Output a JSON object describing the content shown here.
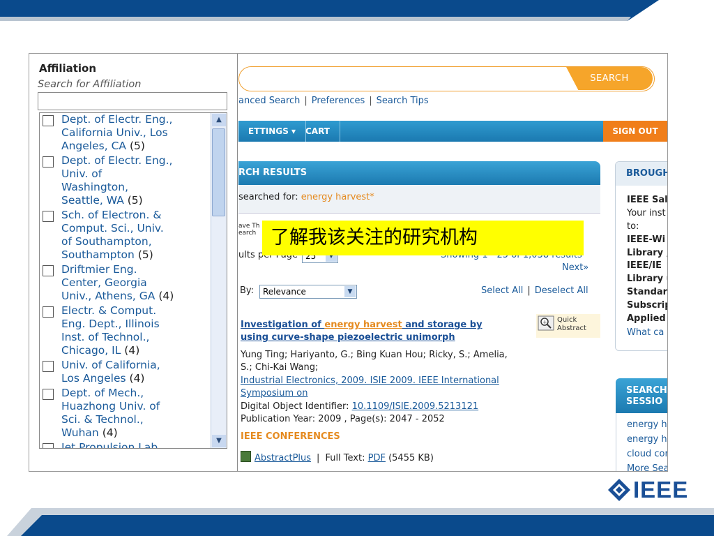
{
  "slide": {
    "callout": "了解我该关注的研究机构",
    "logo_text": "IEEE"
  },
  "header": {
    "search_button": "SEARCH",
    "links": [
      "anced Search",
      "Preferences",
      "Search Tips"
    ]
  },
  "nav": {
    "items": [
      "ETTINGS ▾",
      "CART"
    ],
    "signout": "SIGN OUT"
  },
  "results": {
    "header": "RCH RESULTS",
    "searched_for_label": "searched for:",
    "query": "energy harvest*",
    "save_label": "ave Th\nearch",
    "per_page_label": "ults per Page",
    "per_page_value": "25",
    "showing": "Showing 1 - 25 of 1,038 results",
    "next": "Next»",
    "sort_label": "By:",
    "sort_value": "Relevance",
    "select_all": "Select All",
    "deselect_all": "Deselect All",
    "quick_abstract": "Quick Abstract",
    "item": {
      "title_1": "Investigation of ",
      "title_2": "energy harvest",
      "title_3": " and storage by",
      "title_4": "using curve-shape piezoelectric unimorph",
      "authors_1": "Yung Ting; Hariyanto, G.; Bing Kuan Hou; Ricky, S.; Amelia,",
      "authors_2": "S.; Chi-Kai Wang;",
      "venue_1": "Industrial Electronics, 2009. ISIE 2009. IEEE International",
      "venue_2": "Symposium on",
      "doi_label": "Digital Object Identifier:",
      "doi": "10.1109/ISIE.2009.5213121",
      "pubyear": "Publication Year: 2009 , Page(s): 2047 - 2052",
      "type": "IEEE CONFERENCES",
      "abstractplus": "AbstractPlus",
      "fulltext_label": "Full  Text:",
      "pdf": "PDF",
      "pdf_size": "(5455  KB)"
    }
  },
  "side": {
    "header": "BROUGH",
    "lines": [
      "IEEE Sal",
      "Your inst",
      "to:",
      "IEEE-Wi",
      "Library ,",
      "IEEE/IE",
      "Library u",
      "Standar",
      "Subscrip",
      "Applied",
      "What ca"
    ],
    "session_header_1": "SEARCH",
    "session_header_2": "SESSIO",
    "session_links": [
      "energy h",
      "energy h",
      "cloud cor",
      "More Sea"
    ]
  },
  "panel": {
    "title": "Affiliation",
    "search_placeholder": "Search for Affiliation",
    "items": [
      {
        "lines": [
          "Dept. of Electr. Eng.,",
          "California Univ., Los",
          "Angeles, CA"
        ],
        "count": "(5)"
      },
      {
        "lines": [
          "Dept. of Electr. Eng.,",
          "Univ. of",
          "Washington,",
          "Seattle, WA"
        ],
        "count": "(5)"
      },
      {
        "lines": [
          "Sch. of Electron. &",
          "Comput. Sci., Univ.",
          "of Southampton,",
          "Southampton"
        ],
        "count": "(5)"
      },
      {
        "lines": [
          "Driftmier Eng.",
          "Center, Georgia",
          "Univ., Athens, GA"
        ],
        "count": "(4)"
      },
      {
        "lines": [
          "Electr. & Comput.",
          "Eng. Dept., Illinois",
          "Inst. of Technol.,",
          "Chicago, IL"
        ],
        "count": "(4)"
      },
      {
        "lines": [
          "Univ. of California,",
          "Los Angeles"
        ],
        "count": "(4)"
      },
      {
        "lines": [
          "Dept. of Mech.,",
          "Huazhong Univ. of",
          "Sci. & Technol.,",
          "Wuhan"
        ],
        "count": "(4)"
      },
      {
        "lines": [
          "Jet Propulsion Lab."
        ],
        "count": ""
      }
    ]
  },
  "colors": {
    "band_blue": "#0a4a8c",
    "accent_orange": "#f6a52a",
    "link_blue": "#1a5a9a"
  }
}
